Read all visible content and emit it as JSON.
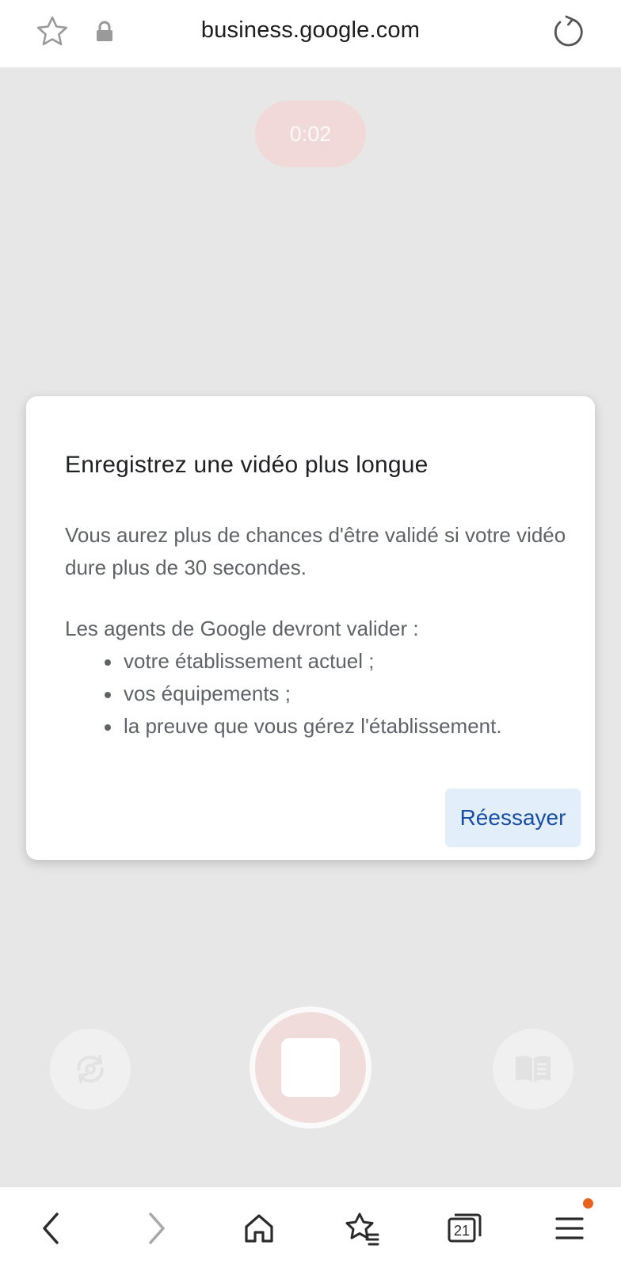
{
  "browser": {
    "url": "business.google.com"
  },
  "recorder": {
    "timer": "0:02"
  },
  "dialog": {
    "title": "Enregistrez une vidéo plus longue",
    "message": "Vous aurez plus de chances d'être validé si votre vidéo dure plus de 30 secondes.",
    "list_intro": "Les agents de Google devront valider :",
    "items": [
      "votre établissement actuel ;",
      "vos équipements ;",
      "la preuve que vous gérez l'établissement."
    ],
    "retry_label": "Réessayer"
  },
  "bottom_nav": {
    "tab_count": "21",
    "has_notification": true
  },
  "colors": {
    "accent": "#174ea6",
    "retry_bg": "#e3eefb",
    "notification": "#e8611e",
    "backdrop": "#e7e7e7"
  }
}
